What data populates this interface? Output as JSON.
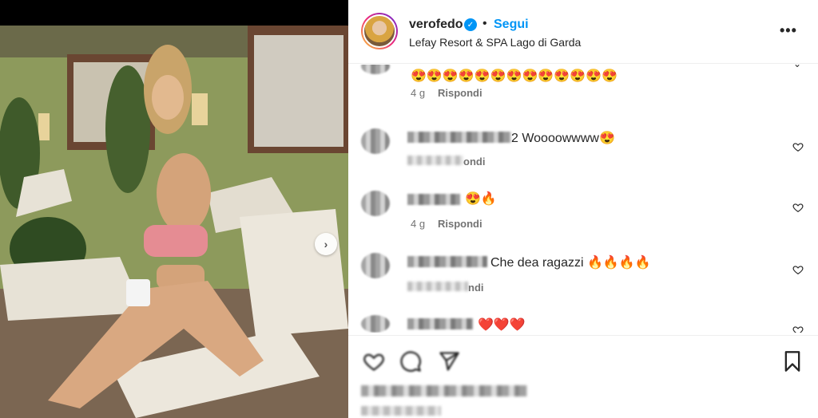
{
  "post": {
    "username": "verofedo",
    "follow_label": "Segui",
    "separator": "•",
    "location": "Lefay Resort & SPA Lago di Garda",
    "more_label": "•••"
  },
  "photo": {
    "next_label": "›"
  },
  "comments": [
    {
      "text": "😍😍😍😍😍😍😍😍😍😍😍😍😍",
      "time": "4 g",
      "reply": "Rispondi"
    },
    {
      "text": "2 Woooowwww😍",
      "time": "",
      "reply": "ondi"
    },
    {
      "text": "😍🔥",
      "time": "4 g",
      "reply": "Rispondi"
    },
    {
      "text": "Che dea ragazzi 🔥🔥🔥🔥",
      "time": "",
      "reply": "ndi"
    },
    {
      "text": "❤️❤️❤️",
      "time": "",
      "reply": ""
    }
  ],
  "colors": {
    "accent": "#0095f6",
    "text": "#262626",
    "muted": "#737373"
  },
  "icons": [
    "verified-icon",
    "more-icon",
    "heart-icon",
    "comment-icon",
    "share-icon",
    "bookmark-icon",
    "next-arrow-icon"
  ]
}
